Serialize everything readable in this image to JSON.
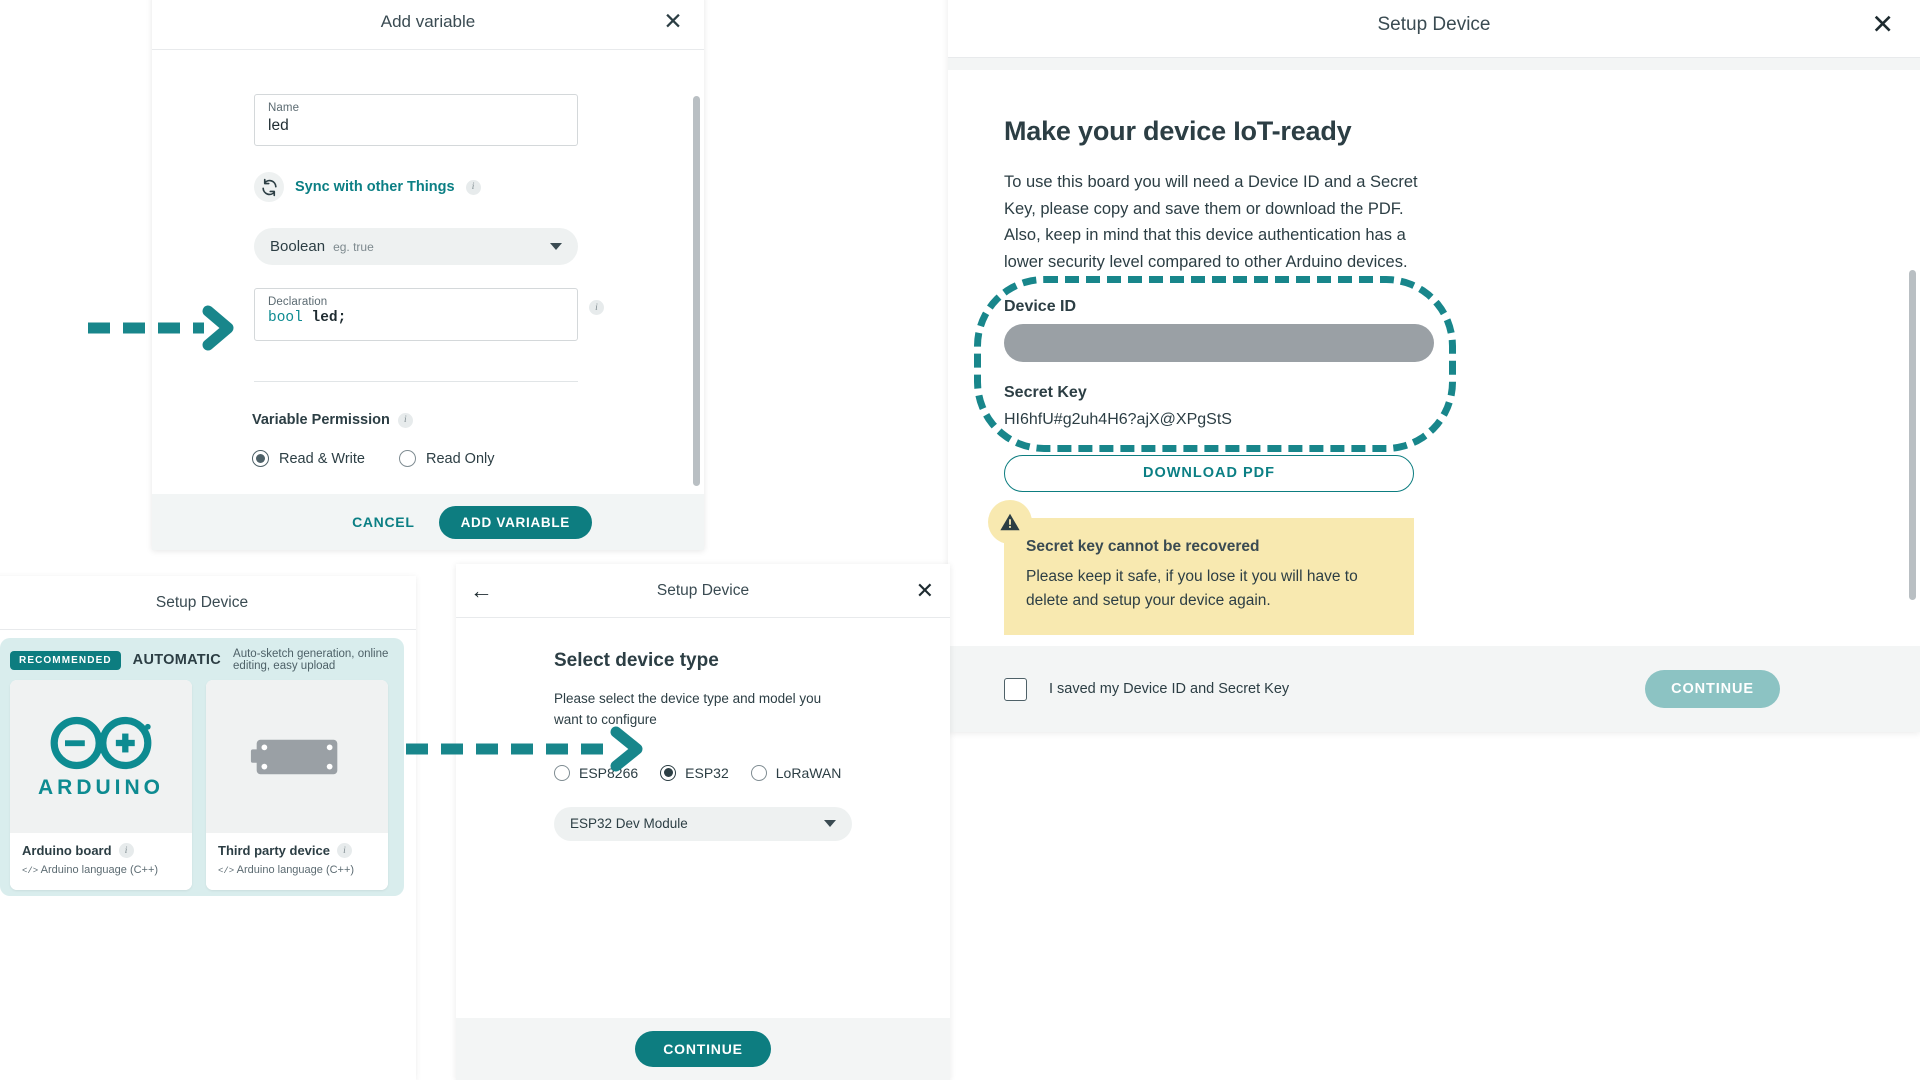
{
  "add_variable_dialog": {
    "title": "Add variable",
    "close_icon": "close-icon",
    "name_field": {
      "label": "Name",
      "value": "led"
    },
    "sync": {
      "icon": "sync-icon",
      "label": "Sync with other Things",
      "info_icon": "info-icon"
    },
    "type_select": {
      "value": "Boolean",
      "hint": "eg. true",
      "caret_icon": "chevron-down-icon"
    },
    "declaration_field": {
      "label": "Declaration",
      "keyword": "bool",
      "identifier": "led",
      "terminator": ";",
      "info_icon": "info-icon"
    },
    "permission": {
      "title": "Variable Permission",
      "info_icon": "info-icon",
      "options": [
        {
          "label": "Read & Write",
          "selected": true
        },
        {
          "label": "Read Only",
          "selected": false
        }
      ]
    },
    "footer": {
      "cancel_label": "CANCEL",
      "submit_label": "ADD VARIABLE"
    }
  },
  "setup_device_right": {
    "title": "Setup Device",
    "close_icon": "close-icon",
    "heading": "Make your device IoT-ready",
    "description": "To use this board you will need a Device ID and a Secret Key, please copy and save them or download the PDF. Also, keep in mind that this device authentication has a lower security level compared to other Arduino devices.",
    "device_id_label": "Device ID",
    "device_id_value": "",
    "secret_key_label": "Secret Key",
    "secret_key_value": "HI6hfU#g2uh4H6?ajX@XPgStS",
    "download_label": "DOWNLOAD PDF",
    "warning": {
      "icon": "warning-icon",
      "title": "Secret key cannot be recovered",
      "text": "Please keep it safe, if you lose it you will have to delete and setup your device again."
    },
    "footer": {
      "checkbox_label": "I saved my Device ID and Secret Key",
      "checkbox_checked": false,
      "continue_label": "CONTINUE"
    }
  },
  "device_picker": {
    "title": "Setup Device",
    "badge": "RECOMMENDED",
    "mode_label": "AUTOMATIC",
    "mode_desc": "Auto-sketch generation, online editing, easy upload",
    "cards": [
      {
        "name": "Arduino board",
        "language": "Arduino language (C++)",
        "logo_text": "ARDUINO",
        "info_icon": "info-icon",
        "thumb_icon": "arduino-logo-icon"
      },
      {
        "name": "Third party device",
        "language": "Arduino language (C++)",
        "info_icon": "info-icon",
        "thumb_icon": "third-party-board-icon"
      }
    ]
  },
  "device_type_panel": {
    "title": "Setup Device",
    "back_icon": "arrow-left-icon",
    "close_icon": "close-icon",
    "heading": "Select device type",
    "subtext": "Please select the device type and model you want to configure",
    "type_options": [
      {
        "label": "ESP8266",
        "selected": false
      },
      {
        "label": "ESP32",
        "selected": true
      },
      {
        "label": "LoRaWAN",
        "selected": false
      }
    ],
    "model_select": {
      "value": "ESP32 Dev Module",
      "caret_icon": "chevron-down-icon"
    },
    "continue_label": "CONTINUE"
  },
  "annotations": {
    "arrow_declaration": "dashed-arrow-right-icon",
    "arrow_device_type": "dashed-arrow-right-icon"
  },
  "colors": {
    "teal": "#0d7d80",
    "teal_dark": "#18868b",
    "warning_bg": "#f8e9b0",
    "group_bg": "#d9eded",
    "footer_bg": "#f3f5f5",
    "continue_disabled": "#8cc3c3"
  }
}
